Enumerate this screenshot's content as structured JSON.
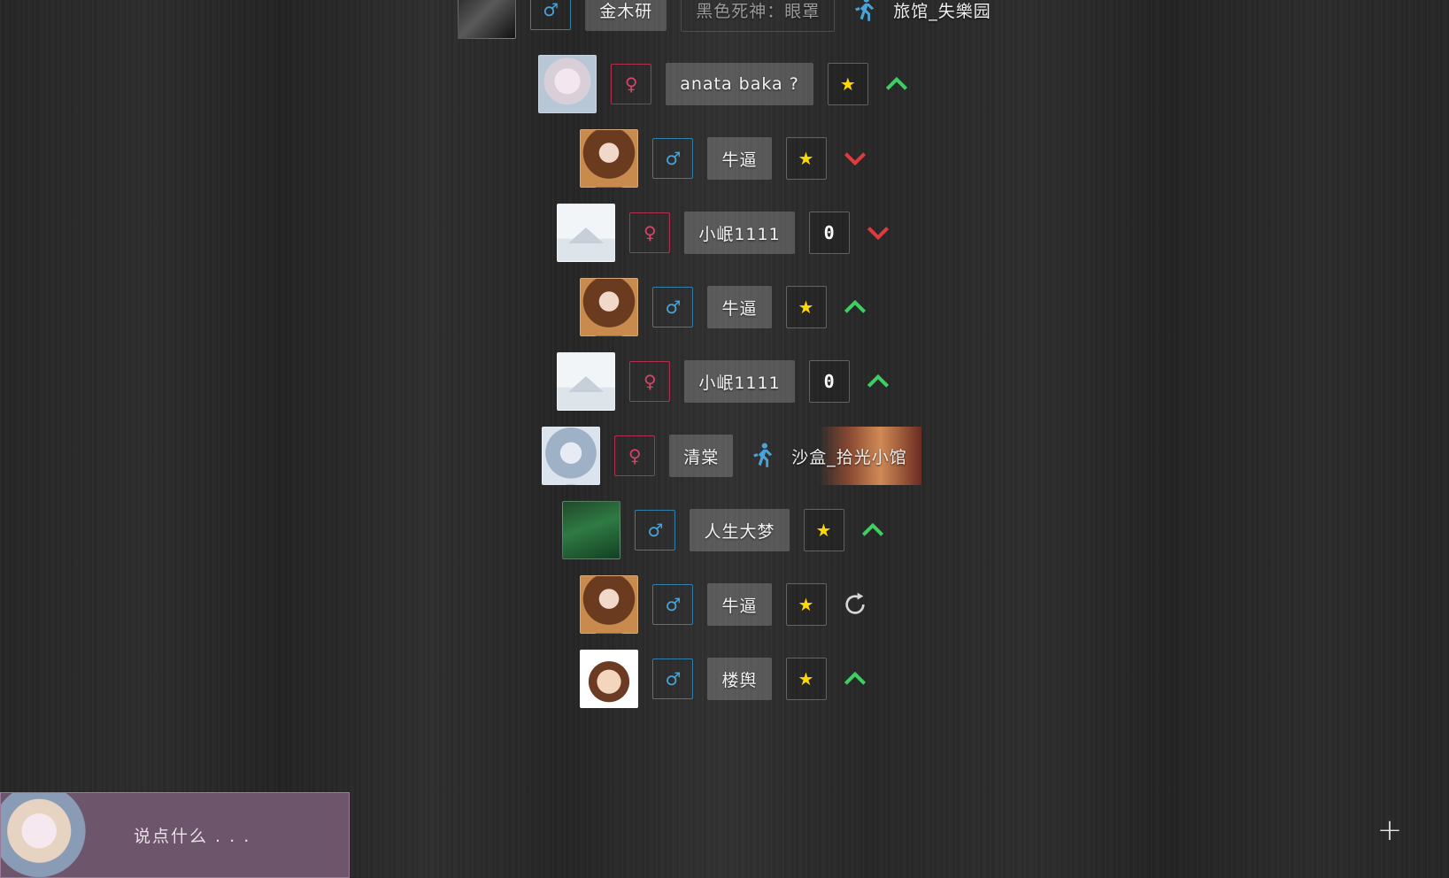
{
  "feed": {
    "rows": [
      {
        "kind": "move",
        "avatar": "dark-portrait",
        "gender": "male",
        "gender_symbol": "♂",
        "name": "金木研",
        "extra": "黑色死神：眼罩",
        "action_icon": "run-icon",
        "room": "旅馆_失樂园"
      },
      {
        "kind": "rank",
        "avatar": "girl-white-hair",
        "gender": "female",
        "gender_symbol": "♀",
        "name": "anata baka ?",
        "badge": "★",
        "trend": "up"
      },
      {
        "kind": "rank",
        "avatar": "girl-brown-hair",
        "gender": "male",
        "gender_symbol": "♂",
        "name": "牛逼",
        "badge": "★",
        "trend": "down"
      },
      {
        "kind": "rank",
        "avatar": "placeholder",
        "gender": "female",
        "gender_symbol": "♀",
        "name": "小岷1111",
        "badge": "0",
        "trend": "down"
      },
      {
        "kind": "rank",
        "avatar": "girl-brown-hair",
        "gender": "male",
        "gender_symbol": "♂",
        "name": "牛逼",
        "badge": "★",
        "trend": "up"
      },
      {
        "kind": "rank",
        "avatar": "placeholder",
        "gender": "female",
        "gender_symbol": "♀",
        "name": "小岷1111",
        "badge": "0",
        "trend": "up"
      },
      {
        "kind": "move",
        "avatar": "blue-hair-girl",
        "gender": "female",
        "gender_symbol": "♀",
        "name": "清棠",
        "action_icon": "run-icon",
        "room": "沙盒_拾光小馆"
      },
      {
        "kind": "rank",
        "avatar": "green-book-cover",
        "gender": "male",
        "gender_symbol": "♂",
        "name": "人生大梦",
        "badge": "★",
        "trend": "up"
      },
      {
        "kind": "rank",
        "avatar": "girl-brown-hair",
        "gender": "male",
        "gender_symbol": "♂",
        "name": "牛逼",
        "badge": "★",
        "trend": "refresh"
      },
      {
        "kind": "rank",
        "avatar": "hello-kitty-girl",
        "gender": "male",
        "gender_symbol": "♂",
        "name": "楼舆",
        "badge": "★",
        "trend": "up"
      }
    ]
  },
  "chat": {
    "placeholder": "说点什么 . . .",
    "plus_label": "+"
  },
  "colors": {
    "male": "#4aa3d8",
    "female": "#d64466",
    "star": "#ffd800",
    "up": "#3ecf63",
    "down": "#e0393e",
    "run": "#4aa3d8",
    "chat_bg": "#6d556b"
  }
}
